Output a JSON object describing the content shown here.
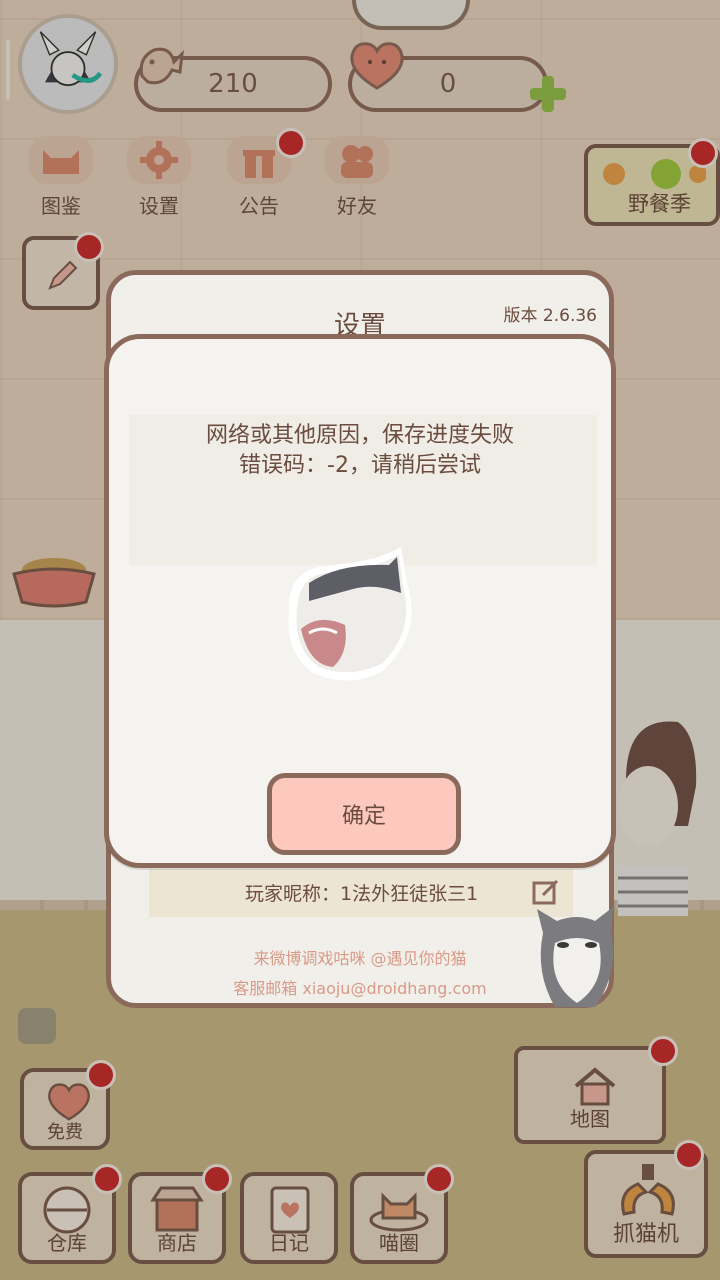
{
  "hud": {
    "fish_count": "210",
    "heart_count": "0"
  },
  "top_menu": [
    {
      "label": "图鉴",
      "icon": "cat-face-icon"
    },
    {
      "label": "设置",
      "icon": "gear-icon"
    },
    {
      "label": "公告",
      "icon": "gift-icon"
    },
    {
      "label": "好友",
      "icon": "friends-icon"
    }
  ],
  "event": {
    "label": "野餐季"
  },
  "settings_panel": {
    "title": "设置",
    "version": "版本 2.6.36",
    "nickname": "玩家昵称：1法外狂徒张三1",
    "weibo": "来微博调戏咕咪 @遇见你的猫",
    "email": "客服邮箱 xiaoju@droidhang.com"
  },
  "dialog": {
    "line1": "网络或其他原因，保存进度失败",
    "line2": "错误码：-2，请稍后尝试",
    "confirm_label": "确定"
  },
  "side_buttons": {
    "map": "地图",
    "claw": "抓猫机",
    "free": "免费"
  },
  "bottom_bar": [
    {
      "label": "仓库",
      "icon": "storage-icon"
    },
    {
      "label": "商店",
      "icon": "shop-icon"
    },
    {
      "label": "日记",
      "icon": "diary-icon"
    },
    {
      "label": "喵圈",
      "icon": "cat-circle-icon"
    }
  ],
  "colors": {
    "accent_red": "#c9292c",
    "confirm_button": "#fdc9bf",
    "border_brown": "#8b6a5c"
  }
}
